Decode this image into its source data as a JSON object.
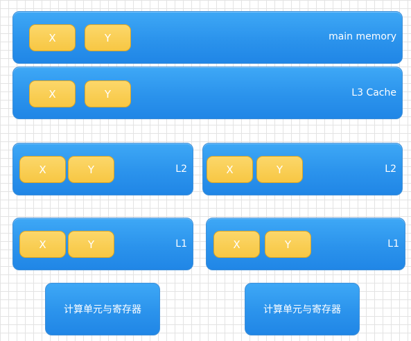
{
  "main_memory": {
    "label": "main memory",
    "x": "X",
    "y": "Y"
  },
  "l3_cache": {
    "label": "L3 Cache",
    "x": "X",
    "y": "Y"
  },
  "l2_left": {
    "label": "L2",
    "x": "X",
    "y": "Y"
  },
  "l2_right": {
    "label": "L2",
    "x": "X",
    "y": "Y"
  },
  "l1_left": {
    "label": "L1",
    "x": "X",
    "y": "Y"
  },
  "l1_right": {
    "label": "L1",
    "x": "X",
    "y": "Y"
  },
  "compute_left": {
    "label": "计算单元与寄存器"
  },
  "compute_right": {
    "label": "计算单元与寄存器"
  },
  "colors": {
    "block_blue": "#2b93ec",
    "value_yellow": "#f7c743",
    "grid": "#e3e3e3"
  }
}
